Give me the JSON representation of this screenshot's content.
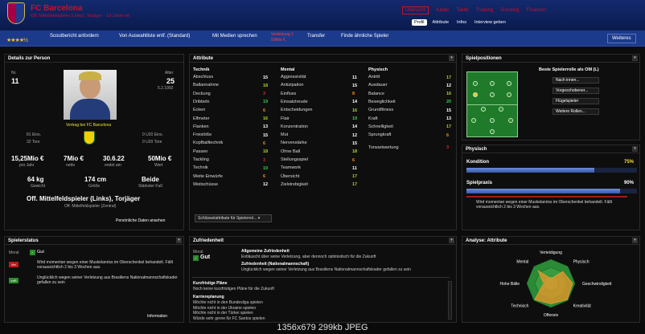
{
  "header": {
    "name": "FC Barcelona",
    "subtitle": "Off. Mittelfeldspieler (Links), Torjäger · 19 Jahre alt"
  },
  "nav": [
    "Übersicht",
    "Kader",
    "Taktik",
    "Training",
    "Scouting",
    "Finanzen"
  ],
  "profile_tabs": [
    "Profil",
    "Attribute",
    "Infos",
    "Interview geben"
  ],
  "toolbar": {
    "stars": "★★★★½",
    "scout": "Scoutbericht anfordern",
    "remove": "Von Auswahlliste entf. (Standard)",
    "media": "Mit Medien sprechen",
    "red1": "Verletzung 1",
    "red2": "50Mio €",
    "transfer": "Transfer",
    "similar": "Finde ähnliche Spieler",
    "more": "Weiteres"
  },
  "details": {
    "title": "Details zur Person",
    "nr_label": "Nr.",
    "nr": "11",
    "age_label": "Alter",
    "age": "25",
    "dob": "5.2.1992",
    "contract_note": "Vertrag bei FC Barcelona",
    "caps1": "81 Eins.",
    "caps2": "32 Tore",
    "caps3": "0 U20 Eins.",
    "caps4": "0 U20 Tore",
    "wage": "15,25Mio €",
    "wage_l": "pro Jahr",
    "netto": "7Mio €",
    "netto_l": "netto",
    "end": "30.6.22",
    "end_l": "endet am",
    "value": "50Mio €",
    "value_l": "Wert",
    "weight": "64 kg",
    "weight_l": "Gewicht",
    "height": "174 cm",
    "height_l": "Größe",
    "foot": "Beide",
    "foot_l": "Stärkster Fuß",
    "role": "Off. Mittelfeldspieler (Links), Torjäger",
    "role_sub": "Off. Mittelfeldspieler (Zentral)",
    "link": "Persönliche Daten ansehen"
  },
  "attributes": {
    "title": "Attribute",
    "col1": "Technik",
    "col2": "Mental",
    "col3": "Physisch",
    "technik": [
      [
        "Abschluss",
        "15"
      ],
      [
        "Ballannahme",
        "18"
      ],
      [
        "Deckung",
        "3"
      ],
      [
        "Dribbeln",
        "19"
      ],
      [
        "Ecken",
        "6"
      ],
      [
        "Elfmeter",
        "16"
      ],
      [
        "Flanken",
        "13"
      ],
      [
        "Freistöße",
        "15"
      ],
      [
        "Kopfballtechnik",
        "6"
      ],
      [
        "Passen",
        "18"
      ],
      [
        "Tackling",
        "3"
      ],
      [
        "Technik",
        "19"
      ],
      [
        "Weite Einwürfe",
        "6"
      ],
      [
        "Weitschüsse",
        "12"
      ]
    ],
    "mental": [
      [
        "Aggressivität",
        "11"
      ],
      [
        "Antizipation",
        "15"
      ],
      [
        "Einfluss",
        "8"
      ],
      [
        "Einsatztreude",
        "14"
      ],
      [
        "Entscheidungen",
        "16"
      ],
      [
        "Flair",
        "19"
      ],
      [
        "Konzentration",
        "14"
      ],
      [
        "Mut",
        "12"
      ],
      [
        "Nervenstärke",
        "15"
      ],
      [
        "Ohne Ball",
        "18"
      ],
      [
        "Stellungsspiel",
        "6"
      ],
      [
        "Teamwork",
        "11"
      ],
      [
        "Übersicht",
        "17"
      ],
      [
        "Zielstrebigkeit",
        "17"
      ]
    ],
    "physisch": [
      [
        "Antritt",
        "17"
      ],
      [
        "Ausdauer",
        "12"
      ],
      [
        "Balance",
        "16"
      ],
      [
        "Beweglichkeit",
        "20"
      ],
      [
        "Grundfitness",
        "15"
      ],
      [
        "Kraft",
        "13"
      ],
      [
        "Schnelligkeit",
        "17"
      ],
      [
        "Sprungkraft",
        "6"
      ]
    ],
    "torwart_label": "Torwartwertung",
    "torwart": "3",
    "dropdown": "Schlüsselattribute für Spielerrol..."
  },
  "positions": {
    "title": "Spielpositionen",
    "best": "Beste Spielerrolle als OM (L)",
    "buttons": [
      "Nach innen...",
      "Vorgeschobener...",
      "Flügelspieler",
      "Weitere Rollen..."
    ]
  },
  "physisch": {
    "title": "Physisch",
    "kondition_label": "Kondition",
    "kondition": "75%",
    "kondition_fill": 0.75,
    "praxis_label": "Spielpraxis",
    "praxis": "90%",
    "praxis_fill": 0.9,
    "note": "Wird momentan wegen einer Muskelanriss im Oberschenkel behandelt. Fällt voraussichtlich 2 bis 3 Wochen aus."
  },
  "status": {
    "title": "Spielerstatus",
    "moral_label": "Moral",
    "moral": "Gut",
    "item1": "Wird momentan wegen einer Muskelanriss im Oberschenkel behandelt. Fällt voraussichtlich 2 bis 3 Wochen aus.",
    "badge1": "Ver",
    "item2": "Unglücklich wegen seiner Verletzung aus Brasiliens Nationalmannschaftskader gefallen zu sein",
    "badge2": "IntR",
    "link": "Information"
  },
  "zufrieden": {
    "title": "Zufriedenheit",
    "moral_label": "Moral",
    "moral": "Gut",
    "h1": "Allgemeine Zufriedenheit",
    "t1": "Entläuscht über seine Verletzung, aber dennoch optimistisch für die Zukunft",
    "h2": "Zufriedenheit (Nationalmannschaft)",
    "t2": "Unglücklich wegen seiner Verletzung aus Brasiliens Nationalmannschaftskader gefallen zu sein",
    "h3": "Kurzfristige Pläne",
    "t3": "Noch keine kurzfristigen Pläne für die Zukunft",
    "h4": "Karriereplanung",
    "lines": [
      "Möchte nicht in den Bundesliga spielen",
      "Möchte nicht in der Ukraine spielen",
      "Möchte nicht in der Türkei spielen",
      "Würde sehr gerne für FC Santos spielen"
    ]
  },
  "analysis": {
    "title": "Analyse: Attribute",
    "labels": [
      "Verteidigung",
      "Physisch",
      "Geschwindigkeit",
      "Kreativität",
      "Offensiv",
      "Technisch",
      "Hohe Bälle",
      "Mental"
    ],
    "values": [
      0.2,
      0.7,
      0.9,
      0.95,
      0.85,
      0.95,
      0.3,
      0.75
    ]
  },
  "footer": "1356x679  299kb  JPEG"
}
